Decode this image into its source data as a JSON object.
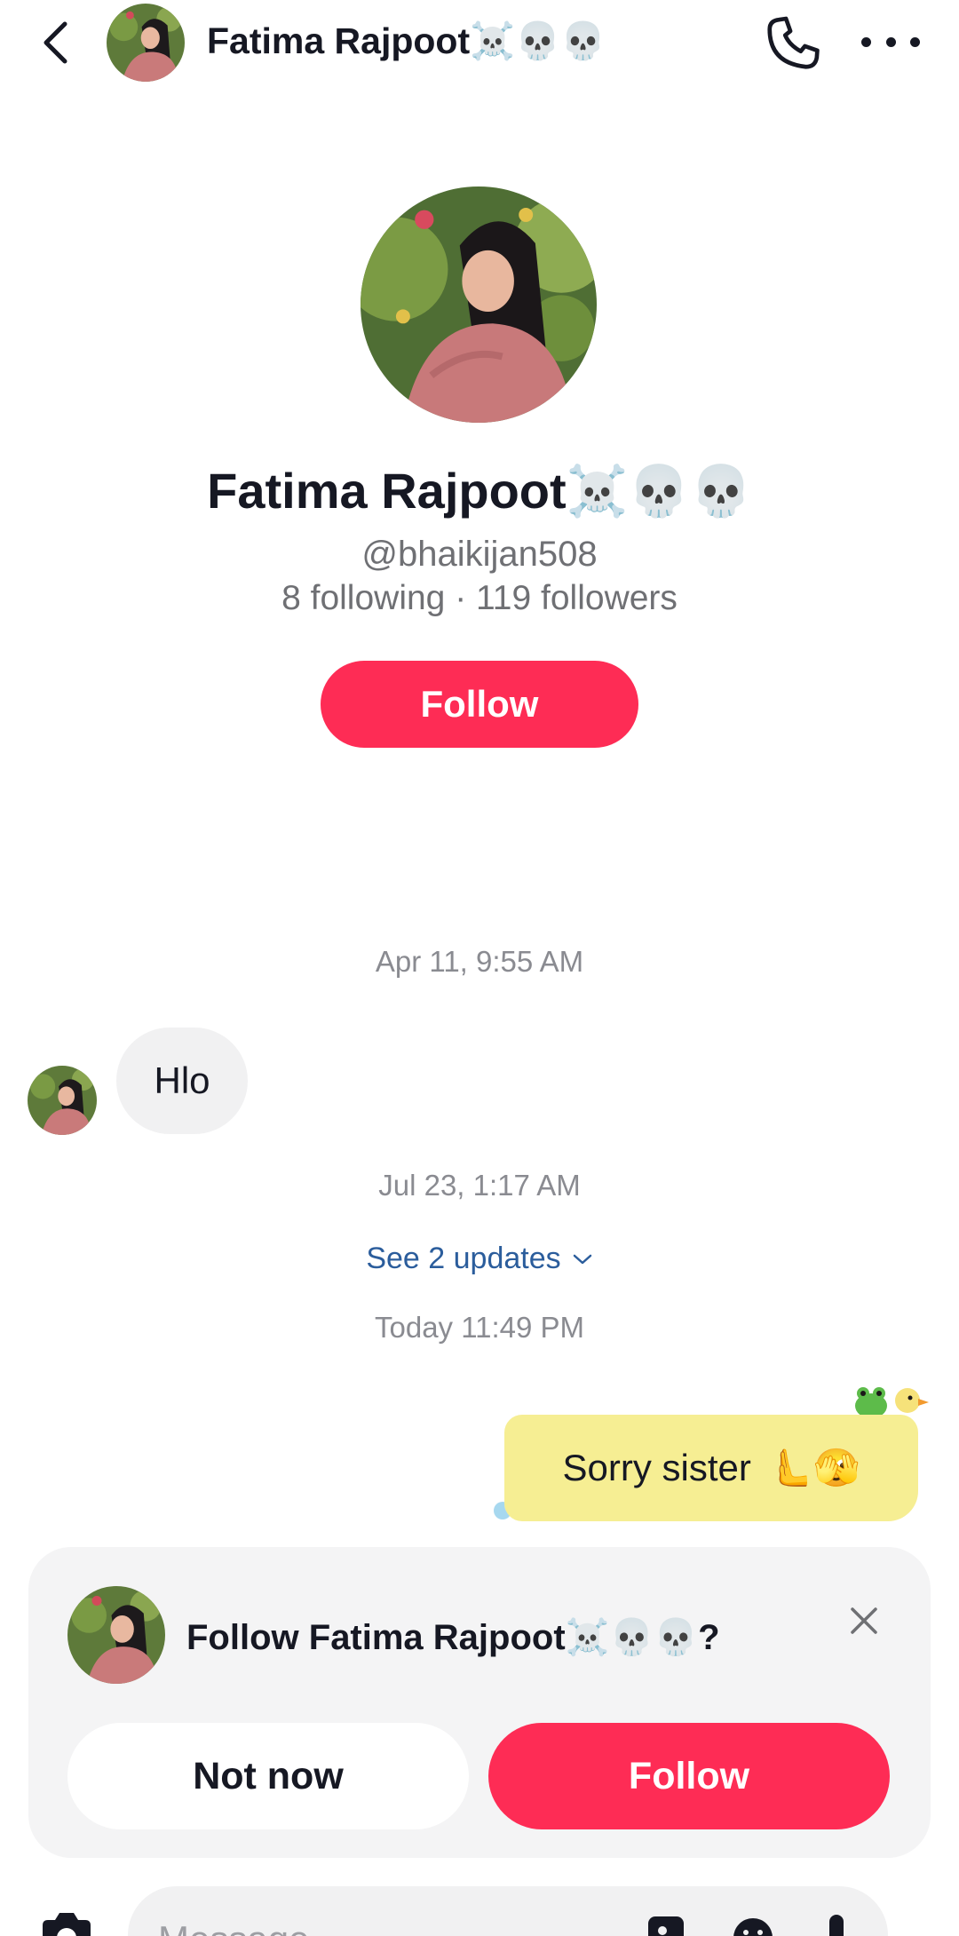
{
  "header": {
    "name": "Fatima Rajpoot",
    "name_emoji": "☠️💀💀",
    "icons": [
      "back-icon",
      "avatar",
      "phone-icon",
      "more-icon"
    ]
  },
  "profile": {
    "name": "Fatima Rajpoot",
    "name_emoji": "☠️💀💀",
    "handle": "@bhaikijan508",
    "stats": "8 following · 119 followers",
    "follow_label": "Follow"
  },
  "chat": {
    "timestamp_1": "Apr 11, 9:55 AM",
    "incoming_message": "Hlo",
    "timestamp_2": "Jul 23, 1:17 AM",
    "updates_link": "See 2 updates",
    "timestamp_3": "Today 11:49 PM",
    "outgoing_message": "Sorry sister",
    "outgoing_emoji": "🫷🫣"
  },
  "follow_card": {
    "title_prefix": "Follow Fatima Rajpoot",
    "title_emoji": "☠️💀💀",
    "title_suffix": "?",
    "not_now_label": "Not now",
    "follow_label": "Follow"
  },
  "composer": {
    "placeholder": "Message"
  },
  "colors": {
    "accent": "#fe2c55",
    "link": "#2b5d9c",
    "bubble_out": "#f6ee93",
    "bubble_in": "#f1f1f2",
    "card_bg": "#f4f4f5"
  }
}
